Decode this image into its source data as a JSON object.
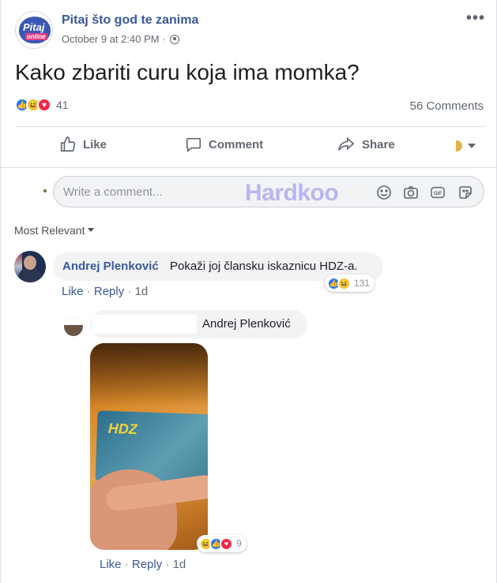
{
  "post": {
    "page_name": "Pitaj što god te zanima",
    "avatar_text_top": "Pitaj",
    "avatar_text_bottom": "online",
    "timestamp": "October 9 at 2:40 PM · ",
    "text": "Kako zbariti curu koja ima momka?",
    "reaction_count": "41",
    "comments_label": "56 Comments",
    "reactions": [
      "like-icon",
      "haha-icon",
      "love-icon"
    ]
  },
  "actions": {
    "like": "Like",
    "comment": "Comment",
    "share": "Share"
  },
  "composer": {
    "placeholder": "Write a comment...",
    "watermark": "Hardkoo",
    "gif_label": "GIF"
  },
  "sort": {
    "label": "Most Relevant"
  },
  "comments": [
    {
      "author": "Andrej Plenković",
      "text": "Pokaži joj člansku iskaznicu HDZ-a.",
      "reaction_count": "131",
      "like": "Like",
      "reply": "Reply",
      "time": "1d"
    },
    {
      "mention": "Andrej Plenković",
      "photo_text": "HDZ",
      "reaction_count": "9",
      "like": "Like",
      "reply": "Reply",
      "time": "1d"
    }
  ],
  "colors": {
    "link": "#385898",
    "like": "#2078f4",
    "love": "#f0284a",
    "haha": "#f7c53c",
    "muted": "#606770"
  }
}
